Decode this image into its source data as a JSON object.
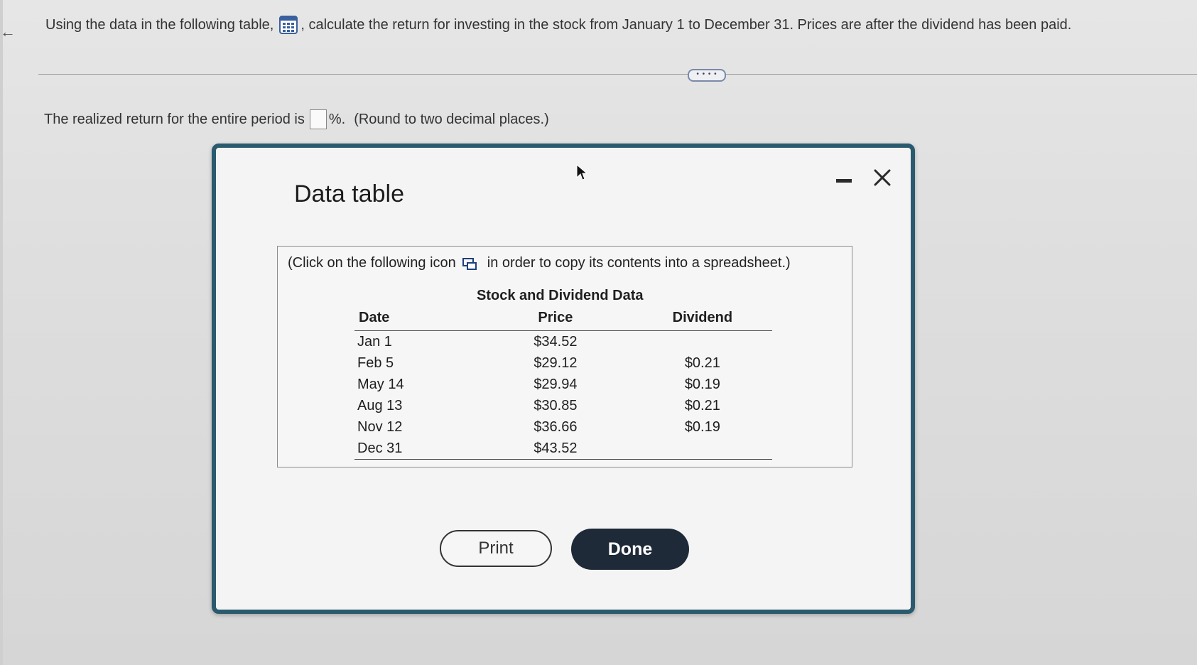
{
  "question": {
    "text_before_icon": "Using the data in the following table,",
    "table_icon": "table-grid-icon",
    "text_after_icon": ", calculate the return for investing in the stock from January 1 to December 31. Prices are after the dividend has been paid."
  },
  "more_button": {
    "label": "• • • •"
  },
  "answer": {
    "text_before": "The realized return for the entire period is",
    "input_value": "",
    "suffix": "%.",
    "hint": "(Round to two decimal places.)"
  },
  "modal": {
    "title": "Data table",
    "minimize_icon": "minimize-icon",
    "close_icon": "close-icon",
    "copy_note_before": "(Click on the following icon",
    "copy_icon": "copy-spreadsheet-icon",
    "copy_note_after": "in order to copy its contents into a spreadsheet.)",
    "table": {
      "caption": "Stock and Dividend Data",
      "headers": {
        "date": "Date",
        "price": "Price",
        "dividend": "Dividend"
      },
      "rows": [
        {
          "date": "Jan 1",
          "price": "$34.52",
          "dividend": ""
        },
        {
          "date": "Feb 5",
          "price": "$29.12",
          "dividend": "$0.21"
        },
        {
          "date": "May 14",
          "price": "$29.94",
          "dividend": "$0.19"
        },
        {
          "date": "Aug 13",
          "price": "$30.85",
          "dividend": "$0.21"
        },
        {
          "date": "Nov 12",
          "price": "$36.66",
          "dividend": "$0.19"
        },
        {
          "date": "Dec 31",
          "price": "$43.52",
          "dividend": ""
        }
      ]
    },
    "buttons": {
      "print": "Print",
      "done": "Done"
    }
  },
  "colors": {
    "modal_border": "#2a5a6e",
    "done_button": "#1e2a38",
    "table_icon_blue": "#3a5f9e"
  }
}
